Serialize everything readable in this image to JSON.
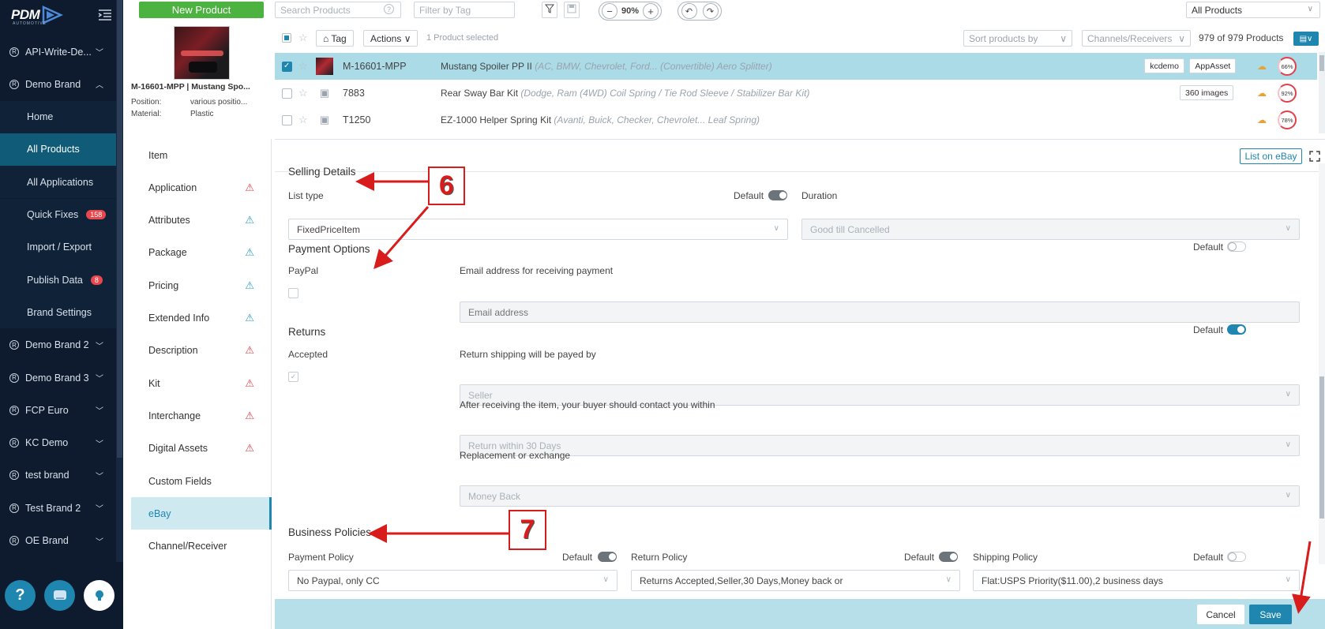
{
  "brand": {
    "logo_text": "PDM",
    "logo_sub": "AUTOMOTIVE"
  },
  "sidebar": {
    "items": [
      {
        "label": "API-Write-De...",
        "type": "brand",
        "expanded": false
      },
      {
        "label": "Demo Brand",
        "type": "brand",
        "expanded": true
      },
      {
        "label": "Home",
        "type": "sub"
      },
      {
        "label": "All Products",
        "type": "sub",
        "active": true
      },
      {
        "label": "All Applications",
        "type": "sub"
      },
      {
        "label": "Quick Fixes",
        "type": "sub",
        "badge": "158"
      },
      {
        "label": "Import / Export",
        "type": "sub"
      },
      {
        "label": "Publish Data",
        "type": "sub",
        "badge": "8"
      },
      {
        "label": "Brand Settings",
        "type": "sub"
      },
      {
        "label": "Demo Brand 2",
        "type": "brand"
      },
      {
        "label": "Demo Brand 3",
        "type": "brand"
      },
      {
        "label": "FCP Euro",
        "type": "brand"
      },
      {
        "label": "KC Demo",
        "type": "brand"
      },
      {
        "label": "test brand",
        "type": "brand"
      },
      {
        "label": "Test Brand 2",
        "type": "brand"
      },
      {
        "label": "OE Brand",
        "type": "brand"
      }
    ],
    "bottom": {
      "help": "?",
      "chat_icon": "chat-icon",
      "bulb_icon": "bulb-icon"
    }
  },
  "toolbar": {
    "new_product": "New Product",
    "search_placeholder": "Search Products",
    "tag_filter_placeholder": "Filter by Tag",
    "zoom": "90%",
    "scope": "All Products"
  },
  "list_header": {
    "tag": "Tag",
    "actions": "Actions",
    "selected": "1 Product selected",
    "sort": "Sort products by",
    "channels": "Channels/Receivers",
    "count": "979 of 979 Products"
  },
  "products": [
    {
      "part": "M-16601-MPP",
      "name": "Mustang Spoiler PP II",
      "desc": "(AC, BMW, Chevrolet, Ford... (Convertible) Aero Splitter)",
      "tags": [
        "kcdemo",
        "AppAsset"
      ],
      "pct": "66%",
      "checked": true
    },
    {
      "part": "7883",
      "name": "Rear Sway Bar Kit",
      "desc": "(Dodge, Ram (4WD) Coil Spring / Tie Rod Sleeve / Stabilizer Bar Kit)",
      "tags": [
        "360 images"
      ],
      "pct": "92%",
      "checked": false
    },
    {
      "part": "T1250",
      "name": "EZ-1000 Helper Spring Kit",
      "desc": "(Avanti, Buick, Checker, Chevrolet... Leaf Spring)",
      "tags": [],
      "pct": "78%",
      "checked": false
    }
  ],
  "preview": {
    "title": "M-16601-MPP | Mustang Spo...",
    "position_label": "Position:",
    "position_value": "various positio...",
    "material_label": "Material:",
    "material_value": "Plastic"
  },
  "tabs": [
    {
      "label": "Item",
      "warn": ""
    },
    {
      "label": "Application",
      "warn": "red"
    },
    {
      "label": "Attributes",
      "warn": "blue"
    },
    {
      "label": "Package",
      "warn": "blue"
    },
    {
      "label": "Pricing",
      "warn": "blue"
    },
    {
      "label": "Extended Info",
      "warn": "blue"
    },
    {
      "label": "Description",
      "warn": "red"
    },
    {
      "label": "Kit",
      "warn": "red"
    },
    {
      "label": "Interchange",
      "warn": "red"
    },
    {
      "label": "Digital Assets",
      "warn": "red"
    },
    {
      "label": "Custom Fields",
      "warn": ""
    },
    {
      "label": "eBay",
      "warn": "",
      "active": true
    },
    {
      "label": "Channel/Receiver",
      "warn": ""
    }
  ],
  "ebay": {
    "list_on_ebay": "List on eBay",
    "selling_details": "Selling Details",
    "list_type_label": "List type",
    "default_label": "Default",
    "duration_label": "Duration",
    "list_type_value": "FixedPriceItem",
    "duration_value": "Good till Cancelled",
    "payment_options": "Payment Options",
    "paypal_label": "PayPal",
    "email_label": "Email address for receiving payment",
    "email_placeholder": "Email address",
    "returns": "Returns",
    "accepted_label": "Accepted",
    "return_shipping_label": "Return shipping will be payed by",
    "return_shipping_value": "Seller",
    "contact_label": "After receiving the item, your buyer should contact you within",
    "contact_value": "Return within 30 Days",
    "replacement_label": "Replacement or exchange",
    "replacement_value": "Money Back",
    "business_policies": "Business Policies",
    "payment_policy_label": "Payment Policy",
    "payment_policy_value": "No Paypal, only CC",
    "return_policy_label": "Return Policy",
    "return_policy_value": "Returns Accepted,Seller,30 Days,Money back or",
    "shipping_policy_label": "Shipping Policy",
    "shipping_policy_value": "Flat:USPS Priority($11.00),2 business days"
  },
  "footer": {
    "cancel": "Cancel",
    "save": "Save"
  },
  "annotations": {
    "six": "6",
    "seven": "7"
  },
  "colors": {
    "accent": "#1f86b0",
    "green": "#4cb240",
    "sidebar_bg": "#0e1b2e",
    "annotation_red": "#d81b1b"
  }
}
